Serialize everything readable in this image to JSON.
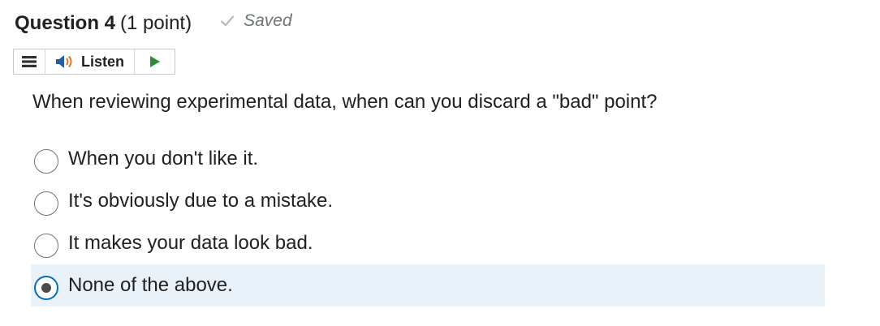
{
  "question": {
    "title": "Question 4",
    "points": "(1 point)",
    "status": "Saved",
    "text": "When reviewing experimental data, when can you discard a \"bad\" point?"
  },
  "readspeaker": {
    "listen_label": "Listen"
  },
  "options": [
    {
      "label": "When you don't like it.",
      "selected": false
    },
    {
      "label": "It's obviously due to a mistake.",
      "selected": false
    },
    {
      "label": "It makes your data look bad.",
      "selected": false
    },
    {
      "label": "None of the above.",
      "selected": true
    }
  ],
  "colors": {
    "selected_bg": "#e9f2f9",
    "radio_checked_border": "#006fbf",
    "play_green": "#2e8b3a",
    "speaker_blue": "#1f5fa8",
    "speaker_orange": "#e8731a"
  },
  "icons": [
    "checkmark-icon",
    "menu-icon",
    "speaker-icon",
    "play-icon"
  ]
}
